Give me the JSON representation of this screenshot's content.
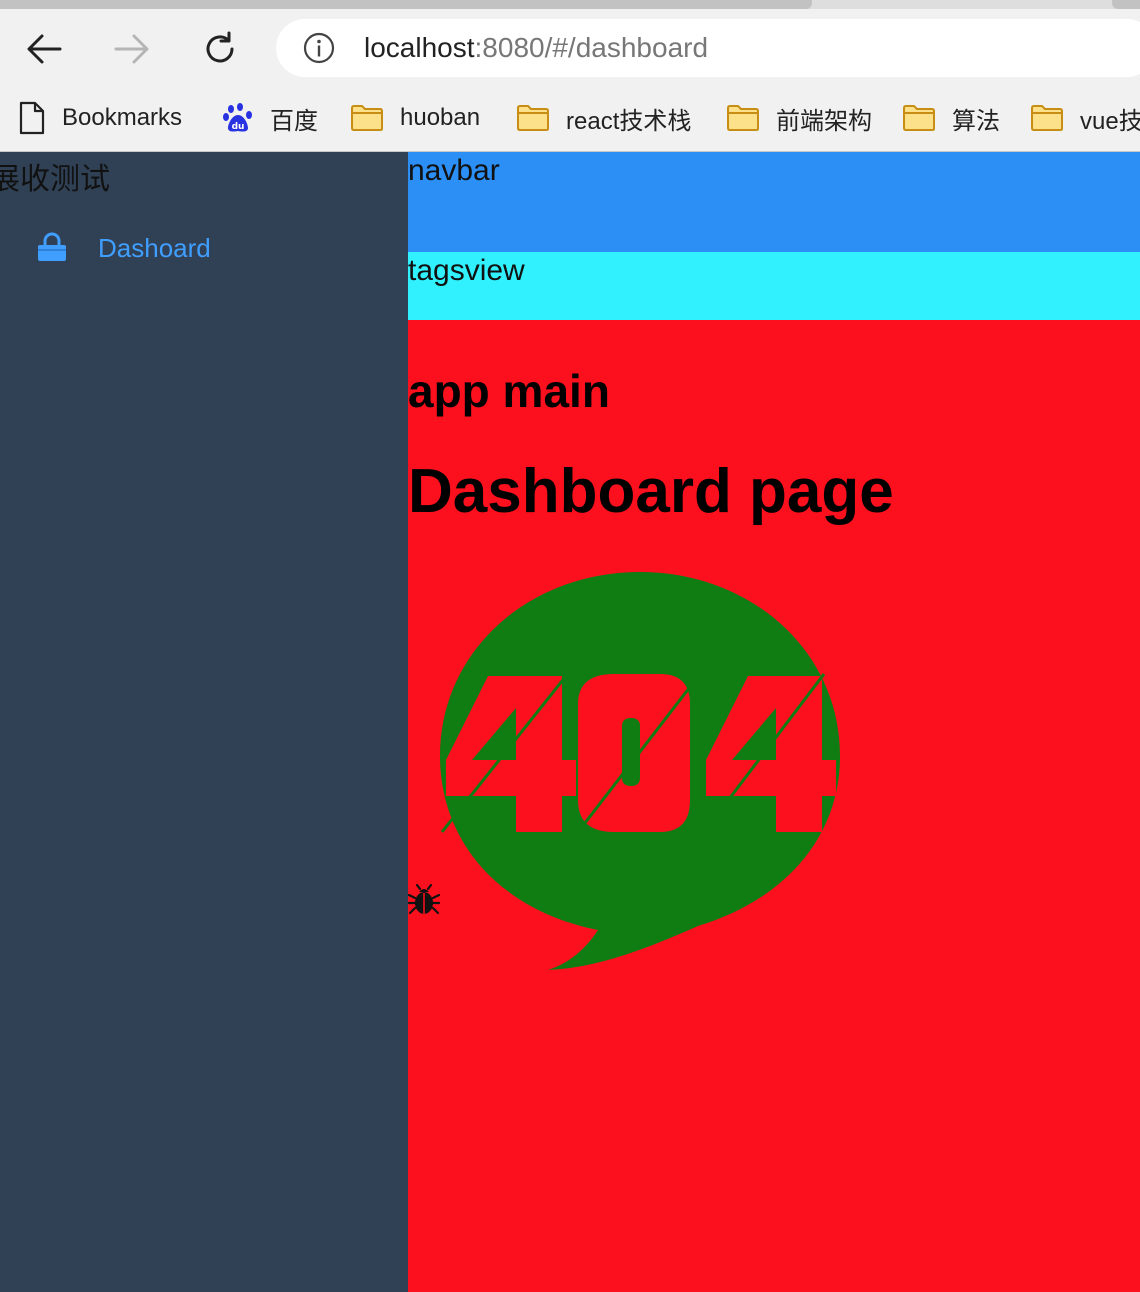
{
  "browser": {
    "url_host": "localhost",
    "url_rest": ":8080/#/dashboard",
    "bookmarks": [
      {
        "label": "Bookmarks",
        "icon": "page-icon"
      },
      {
        "label": "百度",
        "icon": "baidu-icon"
      },
      {
        "label": "huoban",
        "icon": "folder-icon"
      },
      {
        "label": "react技术栈",
        "icon": "folder-icon"
      },
      {
        "label": "前端架构",
        "icon": "folder-icon"
      },
      {
        "label": "算法",
        "icon": "folder-icon"
      },
      {
        "label": "vue技",
        "icon": "folder-icon"
      }
    ]
  },
  "sidebar": {
    "title": "展收测试",
    "menu": [
      {
        "label": "Dashoard",
        "icon": "lock-icon"
      }
    ]
  },
  "navbar": {
    "label": "navbar"
  },
  "tagsview": {
    "label": "tagsview"
  },
  "main": {
    "heading": "app main",
    "page_title": "Dashboard page",
    "image_text": "404"
  },
  "colors": {
    "sidebar_bg": "#304156",
    "navbar_bg": "#2b8ff5",
    "tagsview_bg": "#31f1ff",
    "main_bg": "#fc101e",
    "bubble": "#0f7d12",
    "menu_active": "#409eff"
  }
}
